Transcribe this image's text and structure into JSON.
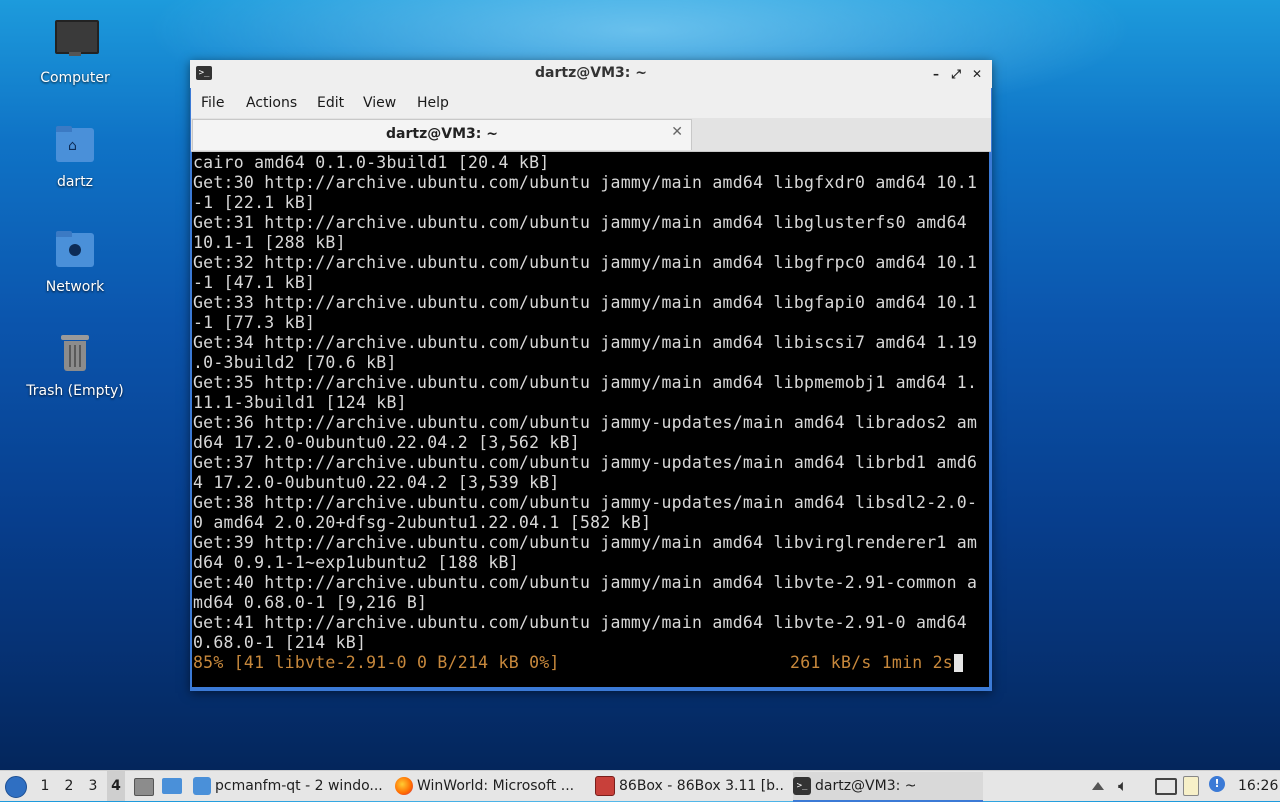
{
  "desktop": {
    "icons": [
      {
        "label": "Computer",
        "icon": "computer-icon"
      },
      {
        "label": "dartz",
        "icon": "home-folder-icon"
      },
      {
        "label": "Network",
        "icon": "network-folder-icon"
      },
      {
        "label": "Trash (Empty)",
        "icon": "trash-icon"
      }
    ]
  },
  "window": {
    "title": "dartz@VM3: ~",
    "controls": {
      "minimize": "–",
      "maximize": "⤢",
      "close": "✕"
    },
    "menu": [
      "File",
      "Actions",
      "Edit",
      "View",
      "Help"
    ],
    "tab": {
      "title": "dartz@VM3: ~",
      "close": "✕"
    },
    "terminal": {
      "lines": [
        "cairo amd64 0.1.0-3build1 [20.4 kB]",
        "Get:30 http://archive.ubuntu.com/ubuntu jammy/main amd64 libgfxdr0 amd64 10.1",
        "-1 [22.1 kB]",
        "Get:31 http://archive.ubuntu.com/ubuntu jammy/main amd64 libglusterfs0 amd64",
        "10.1-1 [288 kB]",
        "Get:32 http://archive.ubuntu.com/ubuntu jammy/main amd64 libgfrpc0 amd64 10.1",
        "-1 [47.1 kB]",
        "Get:33 http://archive.ubuntu.com/ubuntu jammy/main amd64 libgfapi0 amd64 10.1",
        "-1 [77.3 kB]",
        "Get:34 http://archive.ubuntu.com/ubuntu jammy/main amd64 libiscsi7 amd64 1.19",
        ".0-3build2 [70.6 kB]",
        "Get:35 http://archive.ubuntu.com/ubuntu jammy/main amd64 libpmemobj1 amd64 1.",
        "11.1-3build1 [124 kB]",
        "Get:36 http://archive.ubuntu.com/ubuntu jammy-updates/main amd64 librados2 am",
        "d64 17.2.0-0ubuntu0.22.04.2 [3,562 kB]",
        "Get:37 http://archive.ubuntu.com/ubuntu jammy-updates/main amd64 librbd1 amd6",
        "4 17.2.0-0ubuntu0.22.04.2 [3,539 kB]",
        "Get:38 http://archive.ubuntu.com/ubuntu jammy-updates/main amd64 libsdl2-2.0-",
        "0 amd64 2.0.20+dfsg-2ubuntu1.22.04.1 [582 kB]",
        "Get:39 http://archive.ubuntu.com/ubuntu jammy/main amd64 libvirglrenderer1 am",
        "d64 0.9.1-1~exp1ubuntu2 [188 kB]",
        "Get:40 http://archive.ubuntu.com/ubuntu jammy/main amd64 libvte-2.91-common a",
        "md64 0.68.0-1 [9,216 B]",
        "Get:41 http://archive.ubuntu.com/ubuntu jammy/main amd64 libvte-2.91-0 amd64",
        "0.68.0-1 [214 kB]"
      ],
      "status_left": "85% [41 libvte-2.91-0 0 B/214 kB 0%]",
      "status_right": "261 kB/s 1min 2s",
      "status_color": "#c7883c"
    }
  },
  "taskbar": {
    "desktops": [
      "1",
      "2",
      "3",
      "4"
    ],
    "active_desktop": "4",
    "tasks": [
      {
        "label": "pcmanfm-qt - 2 windo...",
        "icon": "folder-icon"
      },
      {
        "label": "WinWorld: Microsoft ...",
        "icon": "firefox-icon"
      },
      {
        "label": "86Box - 86Box 3.11 [b...",
        "icon": "86box-icon"
      },
      {
        "label": "dartz@VM3: ~",
        "icon": "terminal-icon"
      }
    ],
    "clock": "16:26",
    "accent": "#3b7ad6"
  }
}
